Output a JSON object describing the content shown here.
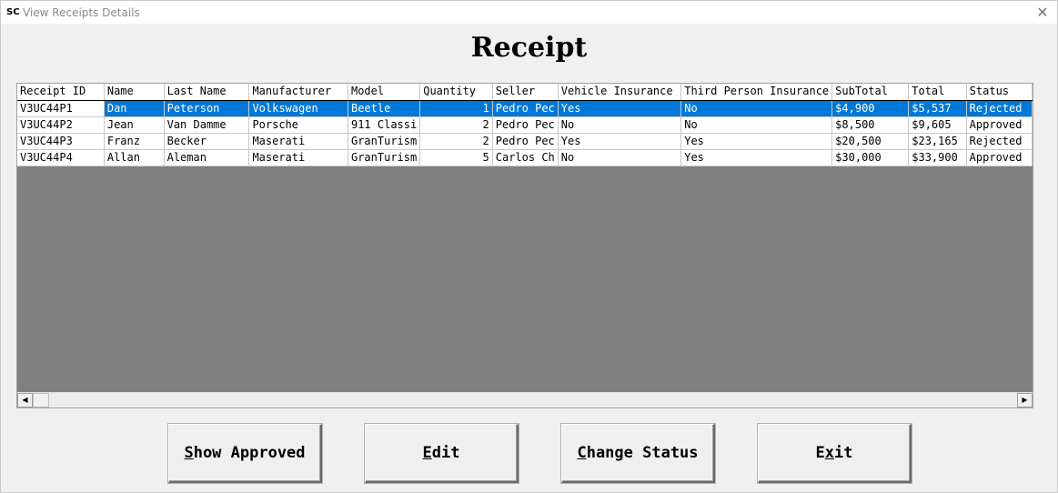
{
  "window": {
    "icon_text": "SC",
    "title": "View Receipts Details",
    "close_glyph": "✕"
  },
  "heading": "Receipt",
  "table": {
    "columns": [
      "Receipt ID",
      "Name",
      "Last Name",
      "Manufacturer",
      "Model",
      "Quantity",
      "Seller",
      "Vehicle Insurance",
      "Third Person Insurance",
      "SubTotal",
      "Total",
      "Status"
    ],
    "rows": [
      [
        "V3UC44P1",
        "Dan",
        "Peterson",
        "Volkswagen",
        "Beetle",
        "1",
        "Pedro Pec",
        "Yes",
        "No",
        "$4,900",
        "$5,537",
        "Rejected"
      ],
      [
        "V3UC44P2",
        "Jean",
        "Van Damme",
        "Porsche",
        "911 Classi",
        "2",
        "Pedro Pec",
        "No",
        "No",
        "$8,500",
        "$9,605",
        "Approved"
      ],
      [
        "V3UC44P3",
        "Franz",
        "Becker",
        "Maserati",
        "GranTurism",
        "2",
        "Pedro Pec",
        "Yes",
        "Yes",
        "$20,500",
        "$23,165",
        "Rejected"
      ],
      [
        "V3UC44P4",
        "Allan",
        "Aleman",
        "Maserati",
        "GranTurism",
        "5",
        "Carlos Ch",
        "No",
        "Yes",
        "$30,000",
        "$33,900",
        "Approved"
      ]
    ],
    "selected_row": 0
  },
  "scrollbar": {
    "left_arrow": "◀",
    "right_arrow": "▶"
  },
  "buttons": [
    {
      "pre": "",
      "key": "S",
      "post": "how Approved"
    },
    {
      "pre": "",
      "key": "E",
      "post": "dit"
    },
    {
      "pre": "",
      "key": "C",
      "post": "hange Status"
    },
    {
      "pre": "E",
      "key": "x",
      "post": "it"
    }
  ],
  "colors": {
    "selection": "#0078d7",
    "grid_background": "#808080"
  }
}
